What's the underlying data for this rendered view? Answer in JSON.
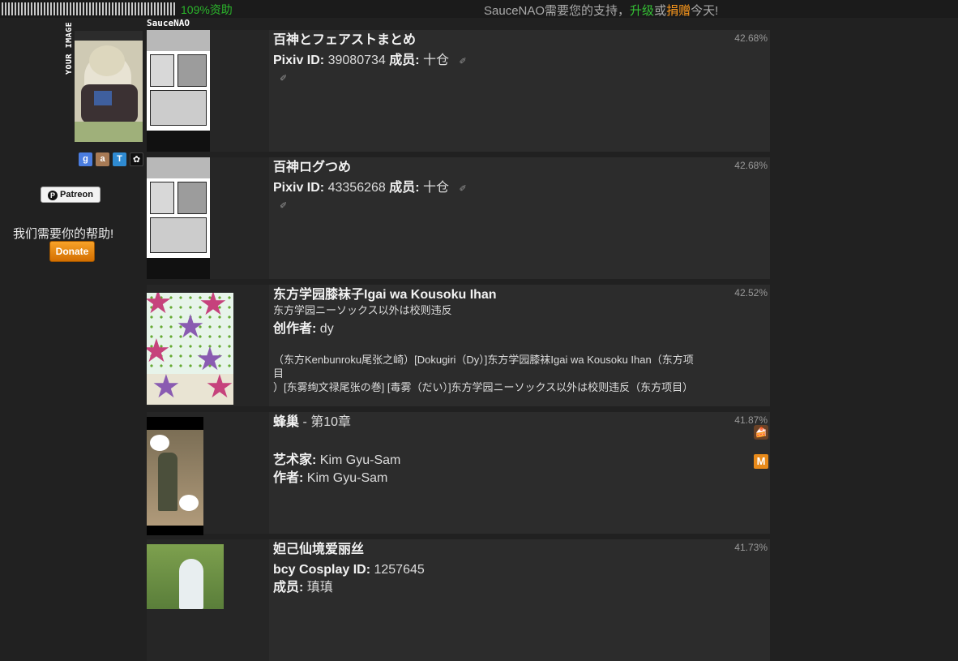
{
  "topbar": {
    "progress_pct": 1.09,
    "progress_label": "109%资助",
    "support_prefix": "SauceNAO需要您的支持，",
    "support_upgrade": "升级",
    "support_or": "或",
    "support_donate": "捐赠",
    "support_suffix": "今天!"
  },
  "left": {
    "your_image_label": "YOUR IMAGE",
    "site_label": "SauceNAO",
    "patreon_label": "Patreon",
    "help_text": "我们需要你的帮助!",
    "donate_label": "Donate",
    "icons": [
      "google-icon",
      "ascii2d-icon",
      "tineye-icon",
      "sauce-icon"
    ]
  },
  "results": [
    {
      "title": "百神とフェアストまとめ",
      "similarity": "42.68%",
      "pixiv_label": "Pixiv ID:",
      "pixiv_id": "39080734",
      "member_label": "成员:",
      "member": "十仓"
    },
    {
      "title": "百神ログつめ",
      "similarity": "42.68%",
      "pixiv_label": "Pixiv ID:",
      "pixiv_id": "43356268",
      "member_label": "成员:",
      "member": "十仓"
    },
    {
      "title": "东方学园膝袜子Igai wa Kousoku Ihan",
      "subtitle": "东方学园ニーソックス以外は校则违反",
      "similarity": "42.52%",
      "creator_label": "创作者:",
      "creator": "dy",
      "source_line1": "（东方Kenbunroku尾张之崎）[Dokugiri（Dy）]东方学园膝袜Igai wa Kousoku Ihan（东方项",
      "source_line2": "目",
      "source_line3": "）[东雾绚文禄尾张の巻] [毒雾（だい）]东方学园ニーソックス以外は校则违反（东方项目）"
    },
    {
      "title": "蜂巢",
      "episode": " - 第10章",
      "similarity": "41.87%",
      "artist_label": "艺术家:",
      "artist": "Kim Gyu-Sam",
      "author_label": "作者:",
      "author": "Kim Gyu-Sam"
    },
    {
      "title": "妲己仙境爱丽丝",
      "similarity": "41.73%",
      "bcy_label": "bcy Cosplay ID:",
      "bcy_id": "1257645",
      "member_label": "成员:",
      "member": "瑱瑱"
    }
  ]
}
